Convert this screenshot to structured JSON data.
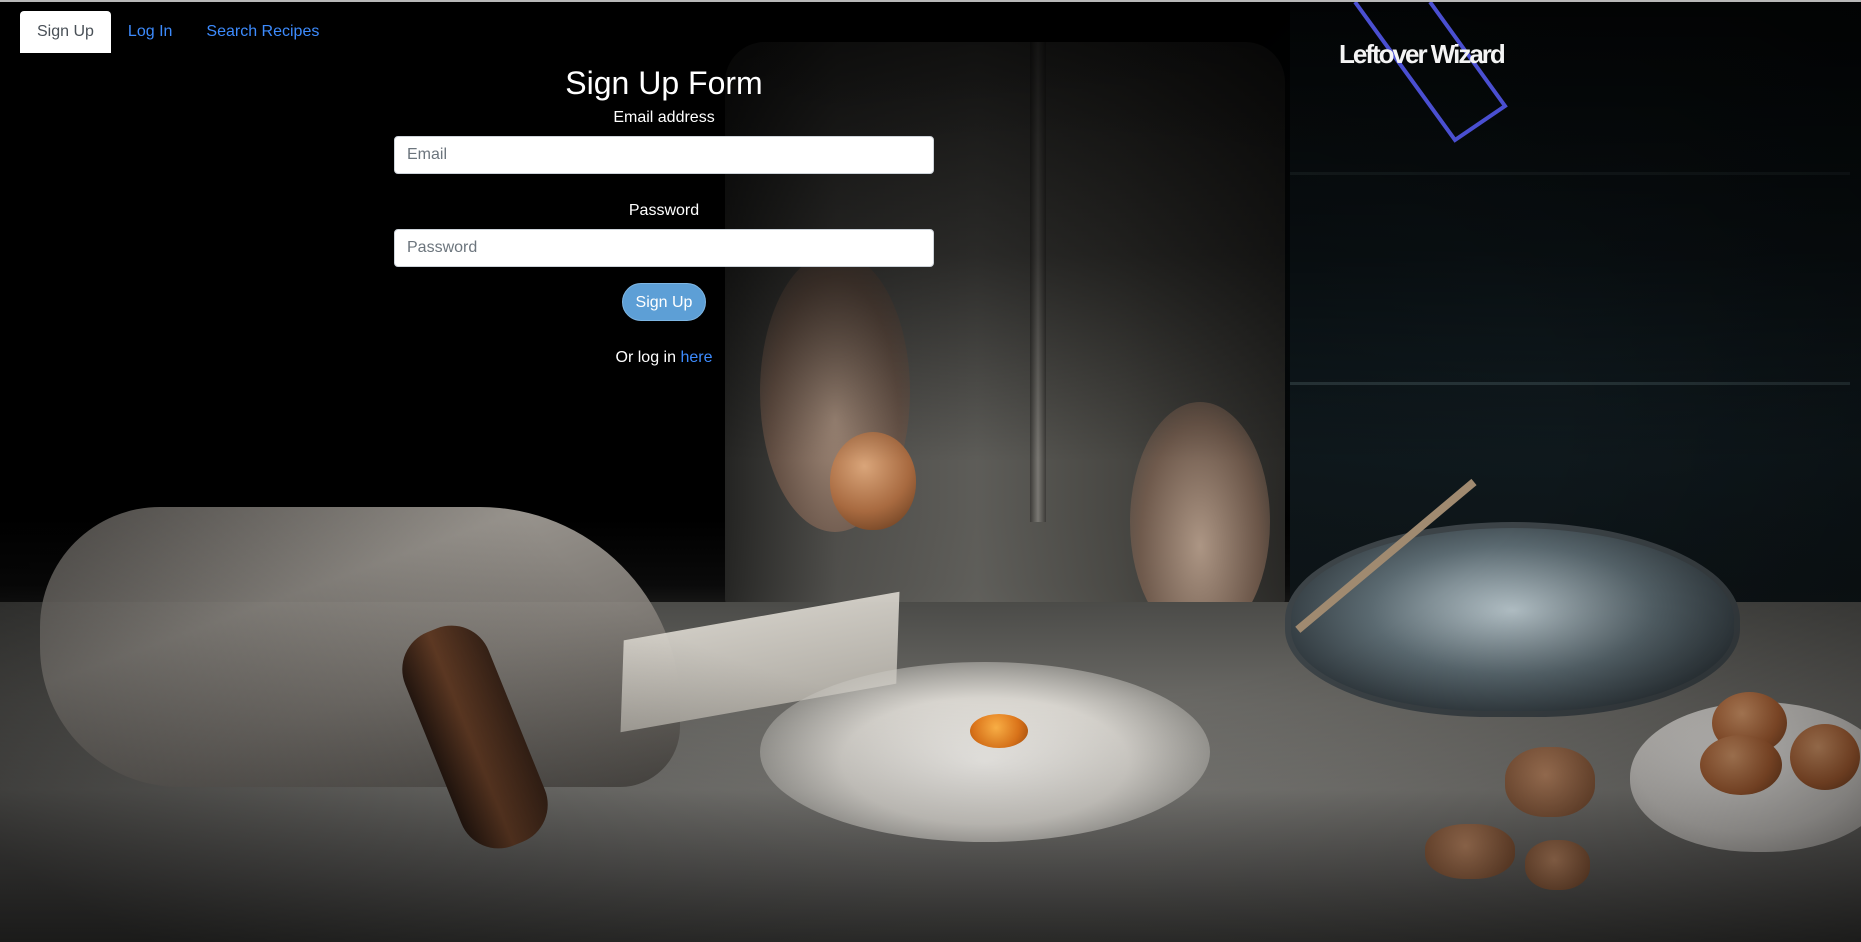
{
  "nav": {
    "items": [
      {
        "label": "Sign Up",
        "active": true
      },
      {
        "label": "Log In",
        "active": false
      },
      {
        "label": "Search Recipes",
        "active": false
      }
    ]
  },
  "logo": {
    "text": "Leftover Wizard",
    "accent_color": "#4a4fd1"
  },
  "form": {
    "title": "Sign Up Form",
    "email_label": "Email address",
    "email_placeholder": "Email",
    "email_value": "",
    "password_label": "Password",
    "password_placeholder": "Password",
    "password_value": "",
    "submit_label": "Sign Up",
    "login_prompt": "Or log in",
    "login_link": "here"
  },
  "colors": {
    "link": "#3d8bfd",
    "button": "#5d9fd6",
    "text": "#ffffff"
  }
}
